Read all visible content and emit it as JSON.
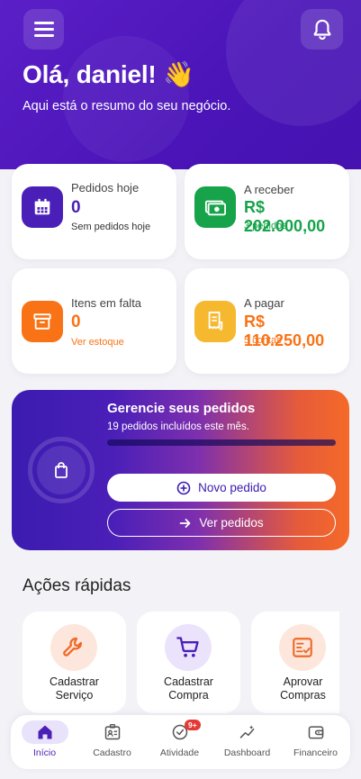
{
  "header": {
    "greeting": "Olá, daniel! 👋",
    "subtitle": "Aqui está o resumo do seu negócio.",
    "menu_icon": "hamburger-menu-icon",
    "bell_icon": "bell-icon"
  },
  "stats": {
    "orders_today": {
      "title": "Pedidos hoje",
      "value": "0",
      "note": "Sem pedidos hoje",
      "icon": "calendar-icon",
      "color": "#4a1fb8"
    },
    "receivable": {
      "title": "A receber",
      "value": "R$ 202.000,00",
      "note": "3 pedidos",
      "icon": "cash-icon",
      "color": "#16a34a"
    },
    "missing_items": {
      "title": "Itens em falta",
      "value": "0",
      "note": "Ver estoque",
      "icon": "archive-box-icon",
      "color": "#f97316"
    },
    "payable": {
      "title": "A pagar",
      "value": "R$ 110.250,00",
      "note": "5 contas",
      "icon": "receipt-icon",
      "color": "#f59e0b"
    }
  },
  "promo": {
    "title": "Gerencie seus pedidos",
    "subtitle": "19 pedidos incluídos este mês.",
    "progress": 0,
    "new_order_label": "Novo pedido",
    "view_orders_label": "Ver pedidos"
  },
  "quick_actions": {
    "title": "Ações rápidas",
    "items": [
      {
        "line1": "Cadastrar",
        "line2": "Serviço",
        "icon": "wrench-icon"
      },
      {
        "line1": "Cadastrar",
        "line2": "Compra",
        "icon": "cart-icon"
      },
      {
        "line1": "Aprovar",
        "line2": "Compras",
        "icon": "approve-list-icon"
      }
    ]
  },
  "nav": {
    "items": [
      {
        "label": "Início",
        "icon": "home-icon"
      },
      {
        "label": "Cadastro",
        "icon": "id-card-icon"
      },
      {
        "label": "Atividade",
        "icon": "check-circle-icon",
        "badge": "9+"
      },
      {
        "label": "Dashboard",
        "icon": "trend-sparkle-icon"
      },
      {
        "label": "Financeiro",
        "icon": "wallet-icon"
      }
    ]
  }
}
